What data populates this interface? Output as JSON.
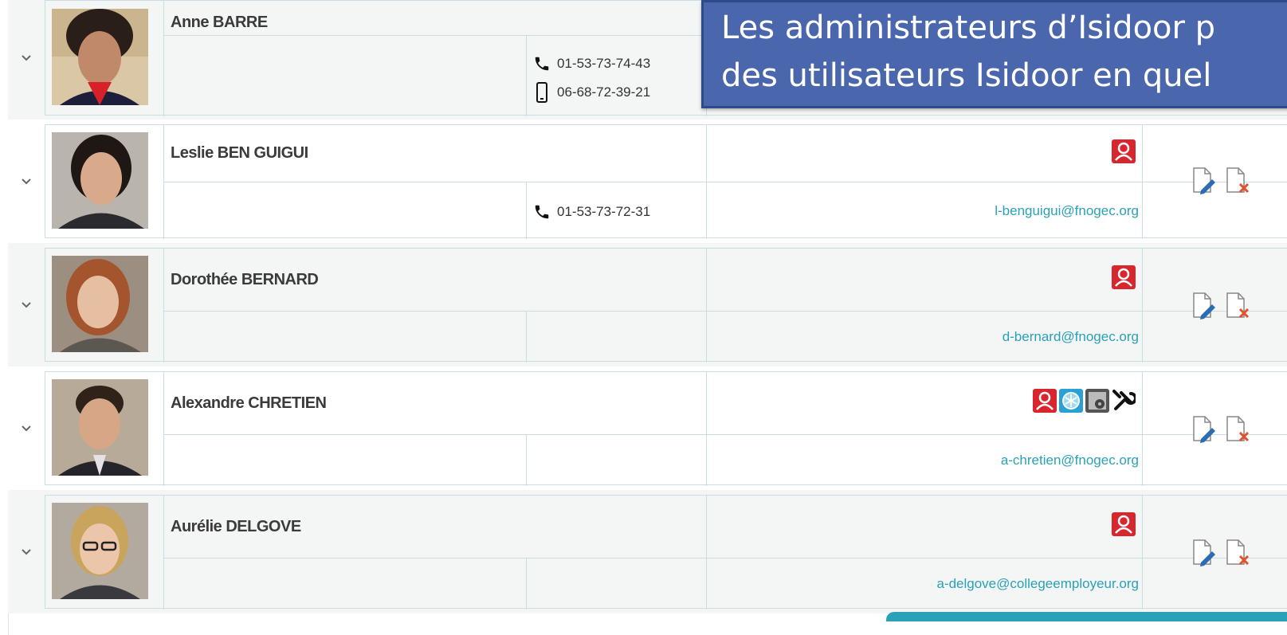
{
  "banner": {
    "line1": "Les administrateurs d’Isidoor p",
    "line2": "des utilisateurs Isidoor en quel"
  },
  "colors": {
    "accent": "#2aa1b7",
    "banner": "#4a67ad",
    "badge_red": "#d7262e"
  },
  "people": [
    {
      "name": "Anne BARRE",
      "phone": "01-53-73-74-43",
      "mobile": "06-68-72-39-21",
      "email": "",
      "badges": []
    },
    {
      "name": "Leslie BEN GUIGUI",
      "phone": "01-53-73-72-31",
      "mobile": "",
      "email": "l-benguigui@fnogec.org",
      "badges": [
        "user-red-icon"
      ]
    },
    {
      "name": "Dorothée BERNARD",
      "phone": "",
      "mobile": "",
      "email": "d-bernard@fnogec.org",
      "badges": [
        "user-red-icon"
      ]
    },
    {
      "name": "Alexandre CHRETIEN",
      "phone": "",
      "mobile": "",
      "email": "a-chretien@fnogec.org",
      "badges": [
        "user-red-icon",
        "snowflake-blue-icon",
        "disk-grey-icon",
        "tools-icon"
      ]
    },
    {
      "name": "Aurélie DELGOVE",
      "phone": "",
      "mobile": "",
      "email": "a-delgove@collegeemployeur.org",
      "badges": [
        "user-red-icon"
      ]
    }
  ]
}
